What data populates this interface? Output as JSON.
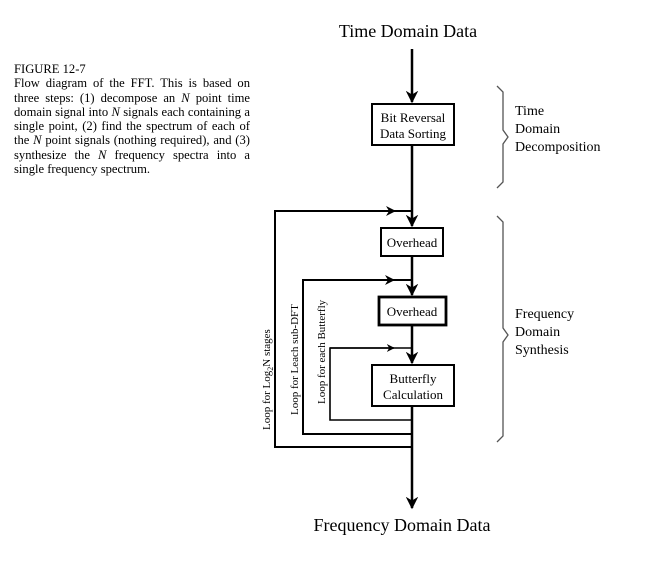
{
  "figure": {
    "label": "FIGURE 12-7",
    "caption_parts": [
      {
        "t": "Flow diagram of the FFT.  This is based on three steps: (1) decompose an ",
        "i": false
      },
      {
        "t": "N",
        "i": true
      },
      {
        "t": " point time domain signal into ",
        "i": false
      },
      {
        "t": "N",
        "i": true
      },
      {
        "t": " signals each containing a single point, (2) find the spectrum of each of the ",
        "i": false
      },
      {
        "t": "N",
        "i": true
      },
      {
        "t": " point signals (nothing required), and (3) synthesize the ",
        "i": false
      },
      {
        "t": "N",
        "i": true
      },
      {
        "t": " frequency spectra into a single frequency spectrum.",
        "i": false
      }
    ]
  },
  "diagram": {
    "input_label": "Time Domain Data",
    "output_label": "Frequency Domain Data",
    "boxes": {
      "bit_reversal": [
        "Bit Reversal",
        "Data Sorting"
      ],
      "overhead_stage": "Overhead",
      "overhead_subdft": "Overhead",
      "butterfly": [
        "Butterfly",
        "Calculation"
      ]
    },
    "loops": {
      "outer": {
        "text": "Loop for Log",
        "sub": "2",
        "tail": "N stages"
      },
      "middle": "Loop for Leach sub-DFT",
      "inner": "Loop for each Butterfly"
    },
    "braces": {
      "decomposition": [
        "Time",
        "Domain",
        "Decomposition"
      ],
      "synthesis": [
        "Frequency",
        "Domain",
        "Synthesis"
      ]
    }
  }
}
